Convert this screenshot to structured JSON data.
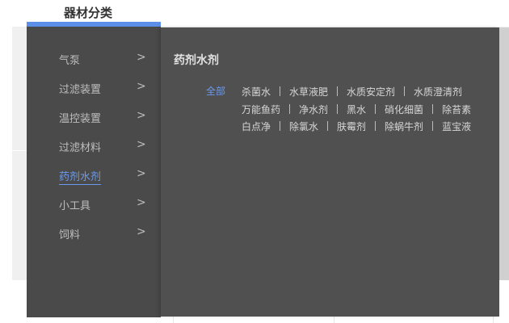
{
  "tab": {
    "title": "器材分类"
  },
  "menu": [
    {
      "label": "气泵"
    },
    {
      "label": "过滤装置"
    },
    {
      "label": "温控装置"
    },
    {
      "label": "过滤材料"
    },
    {
      "label": "药剂水剂",
      "active": true
    },
    {
      "label": "小工具"
    },
    {
      "label": "饲料"
    }
  ],
  "panel": {
    "title": "药剂水剂",
    "all_label": "全部",
    "rows": [
      [
        "杀菌水",
        "水草液肥",
        "水质安定剂",
        "水质澄清剂"
      ],
      [
        "万能鱼药",
        "净水剂",
        "黑水",
        "硝化细菌",
        "除苔素"
      ],
      [
        "白点净",
        "除氯水",
        "肤霉剂",
        "除蜗牛剂",
        "蓝宝液"
      ]
    ]
  },
  "colors": {
    "accent": "#5b8fe8",
    "menu_bg": "#4a4a4a",
    "panel_bg": "#505050"
  }
}
